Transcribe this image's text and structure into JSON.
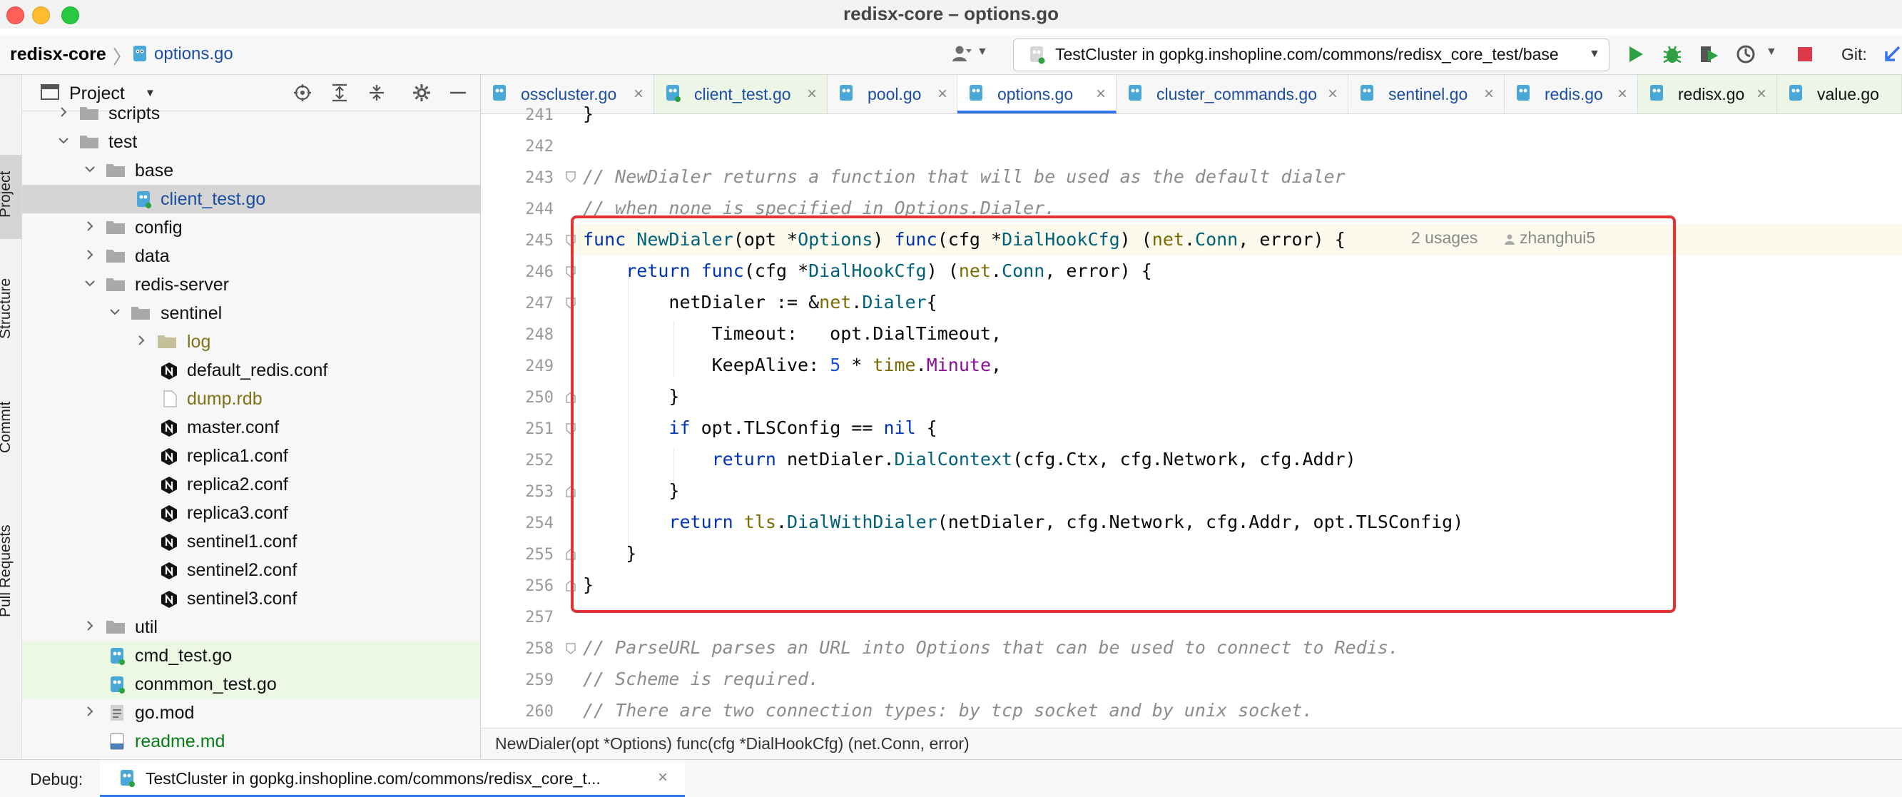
{
  "window": {
    "title": "redisx-core – options.go"
  },
  "navbar": {
    "project": "redisx-core",
    "file": "options.go",
    "run_config": "TestCluster in gopkg.inshopline.com/commons/redisx_core_test/base",
    "git_label": "Git:"
  },
  "left_stripe": {
    "items": [
      "Project",
      "Structure",
      "Commit",
      "Pull Requests"
    ]
  },
  "project_panel": {
    "title": "Project",
    "tree": [
      {
        "label": "scripts",
        "icon": "folder-icon",
        "tone": "default"
      },
      {
        "label": "test",
        "icon": "folder-icon",
        "tone": "default"
      },
      {
        "label": "base",
        "icon": "folder-icon",
        "tone": "default"
      },
      {
        "label": "client_test.go",
        "icon": "go-test-file-icon",
        "tone": "blue"
      },
      {
        "label": "config",
        "icon": "folder-icon",
        "tone": "default"
      },
      {
        "label": "data",
        "icon": "folder-icon",
        "tone": "default"
      },
      {
        "label": "redis-server",
        "icon": "folder-icon",
        "tone": "default"
      },
      {
        "label": "sentinel",
        "icon": "folder-icon",
        "tone": "default"
      },
      {
        "label": "log",
        "icon": "folder-icon",
        "tone": "olive"
      },
      {
        "label": "default_redis.conf",
        "icon": "nginx-config-icon",
        "tone": "default"
      },
      {
        "label": "dump.rdb",
        "icon": "text-file-icon",
        "tone": "olive"
      },
      {
        "label": "master.conf",
        "icon": "nginx-config-icon",
        "tone": "default"
      },
      {
        "label": "replica1.conf",
        "icon": "nginx-config-icon",
        "tone": "default"
      },
      {
        "label": "replica2.conf",
        "icon": "nginx-config-icon",
        "tone": "default"
      },
      {
        "label": "replica3.conf",
        "icon": "nginx-config-icon",
        "tone": "default"
      },
      {
        "label": "sentinel1.conf",
        "icon": "nginx-config-icon",
        "tone": "default"
      },
      {
        "label": "sentinel2.conf",
        "icon": "nginx-config-icon",
        "tone": "default"
      },
      {
        "label": "sentinel3.conf",
        "icon": "nginx-config-icon",
        "tone": "default"
      },
      {
        "label": "util",
        "icon": "folder-icon",
        "tone": "default"
      },
      {
        "label": "cmd_test.go",
        "icon": "go-test-file-icon",
        "tone": "default"
      },
      {
        "label": "conmmon_test.go",
        "icon": "go-test-file-icon",
        "tone": "default"
      },
      {
        "label": "go.mod",
        "icon": "go-mod-icon",
        "tone": "default"
      },
      {
        "label": "readme.md",
        "icon": "markdown-icon",
        "tone": "green"
      }
    ]
  },
  "tabs": [
    {
      "label": "osscluster.go"
    },
    {
      "label": "client_test.go"
    },
    {
      "label": "pool.go"
    },
    {
      "label": "options.go"
    },
    {
      "label": "cluster_commands.go"
    },
    {
      "label": "sentinel.go"
    },
    {
      "label": "redis.go"
    },
    {
      "label": "redisx.go"
    },
    {
      "label": "value.go"
    }
  ],
  "editor": {
    "line_numbers": [
      "241",
      "242",
      "243",
      "244",
      "245",
      "246",
      "247",
      "248",
      "249",
      "250",
      "251",
      "252",
      "253",
      "254",
      "255",
      "256",
      "257",
      "258",
      "259",
      "260"
    ],
    "code_lines": [
      "}",
      "",
      "// NewDialer returns a function that will be used as the default dialer",
      "// when none is specified in Options.Dialer.",
      "func NewDialer(opt *Options) func(cfg *DialHookCfg) (net.Conn, error) {",
      "    return func(cfg *DialHookCfg) (net.Conn, error) {",
      "        netDialer := &net.Dialer{",
      "            Timeout:   opt.DialTimeout,",
      "            KeepAlive: 5 * time.Minute,",
      "        }",
      "        if opt.TLSConfig == nil {",
      "            return netDialer.DialContext(cfg.Ctx, cfg.Network, cfg.Addr)",
      "        }",
      "        return tls.DialWithDialer(netDialer, cfg.Network, cfg.Addr, opt.TLSConfig)",
      "    }",
      "}",
      "",
      "// ParseURL parses an URL into Options that can be used to connect to Redis.",
      "// Scheme is required.",
      "// There are two connection types: by tcp socket and by unix socket."
    ],
    "usages_hint": "2 usages",
    "author_hint": "zhanghui5"
  },
  "status_line": "NewDialer(opt *Options) func(cfg *DialHookCfg) (net.Conn, error)",
  "debug": {
    "label": "Debug:",
    "tab_label": "TestCluster in gopkg.inshopline.com/commons/redisx_core_t..."
  },
  "colors": {
    "accent": "#3574f0",
    "highlight_box": "#e53333",
    "keyword": "#0033b3",
    "function": "#00627a"
  }
}
